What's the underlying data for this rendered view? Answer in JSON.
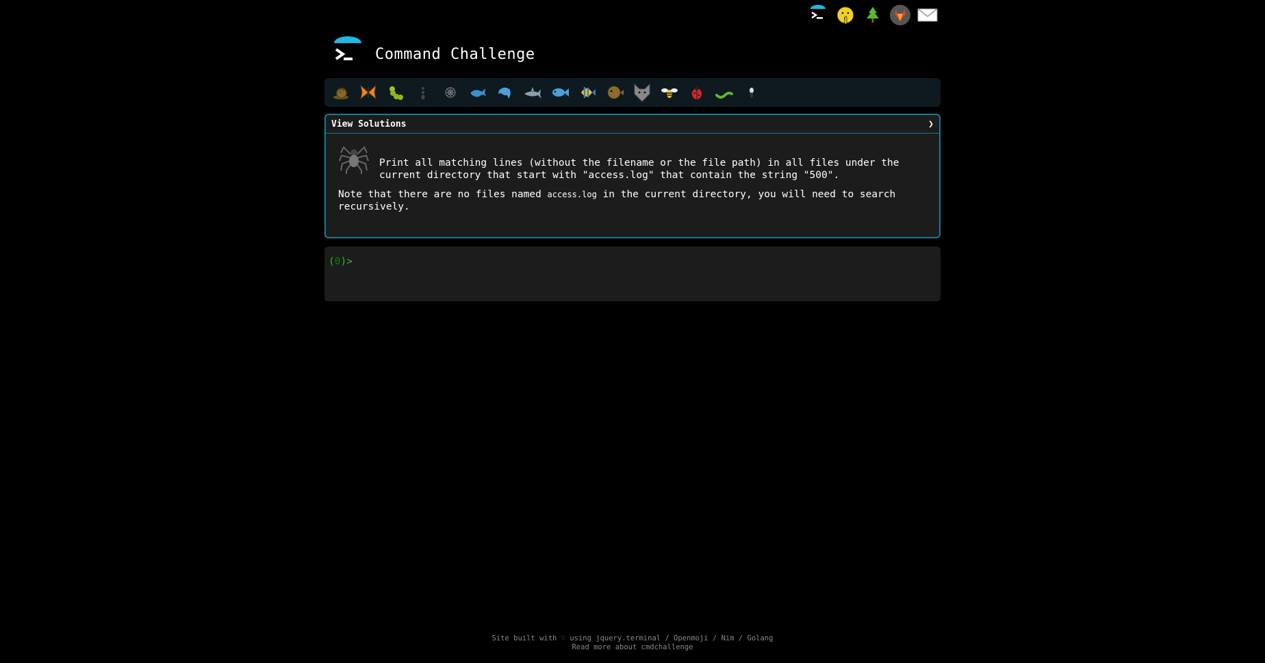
{
  "header": {
    "title": "Command Challenge"
  },
  "top_icons": [
    "terminal-logo-icon",
    "shushing-face-icon",
    "tree-icon",
    "gitlab-fox-icon",
    "mail-icon"
  ],
  "levels": [
    "snail-icon",
    "butterfly-icon",
    "caterpillar-icon",
    "ant-icon",
    "spider-web-icon",
    "whale-icon",
    "dolphin-icon",
    "shark-icon",
    "fish-icon",
    "tropical-fish-icon",
    "blowfish-icon",
    "wolf-icon",
    "bee-icon",
    "ladybug-icon",
    "worm-icon",
    "mosquito-icon"
  ],
  "challenge": {
    "solutions_label": "View Solutions",
    "solutions_chevron": "❯",
    "description": "Print all matching lines (without the filename or the file path) in all files under the current directory that start with \"access.log\" that contain the string \"500\".",
    "note_before": "Note that there are no files named ",
    "note_code": "access.log",
    "note_after": " in the current directory, you will need to search recursively."
  },
  "terminal": {
    "prompt_open": "(",
    "prompt_count": "0",
    "prompt_close": ")>"
  },
  "footer": {
    "line1_before": "Site built with ",
    "heart": "♡",
    "line1_after": " using jquery.terminal / Openmoji / Nim / Golang",
    "line2": "Read more about cmdchallenge"
  },
  "colors": {
    "accent": "#1a7a9a",
    "logo_cyan": "#1eb8e0",
    "prompt_green": "#2fbf2f"
  }
}
